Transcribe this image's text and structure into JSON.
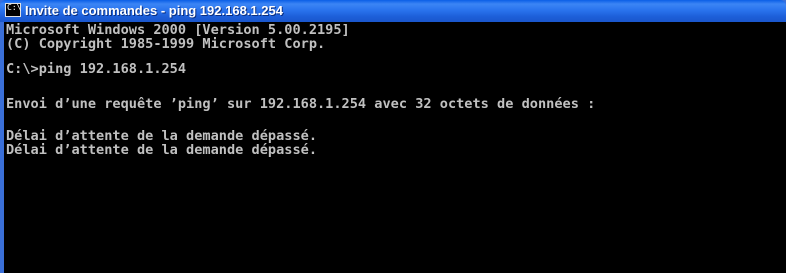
{
  "window": {
    "title": "Invite de commandes - ping 192.168.1.254",
    "icon": "command-prompt-icon",
    "icon_glyph": "C:\\",
    "title_bar_color": "#2a74ee",
    "console_background": "#000000",
    "console_text_color": "#c0c0c0"
  },
  "console": {
    "lines": [
      "Microsoft Windows 2000 [Version 5.00.2195]",
      "(C) Copyright 1985-1999 Microsoft Corp.",
      "C:\\>ping 192.168.1.254",
      "Envoi d’une requête ’ping’ sur 192.168.1.254 avec 32 octets de données :",
      "Délai d’attente de la demande dépassé.",
      "Délai d’attente de la demande dépassé."
    ]
  }
}
